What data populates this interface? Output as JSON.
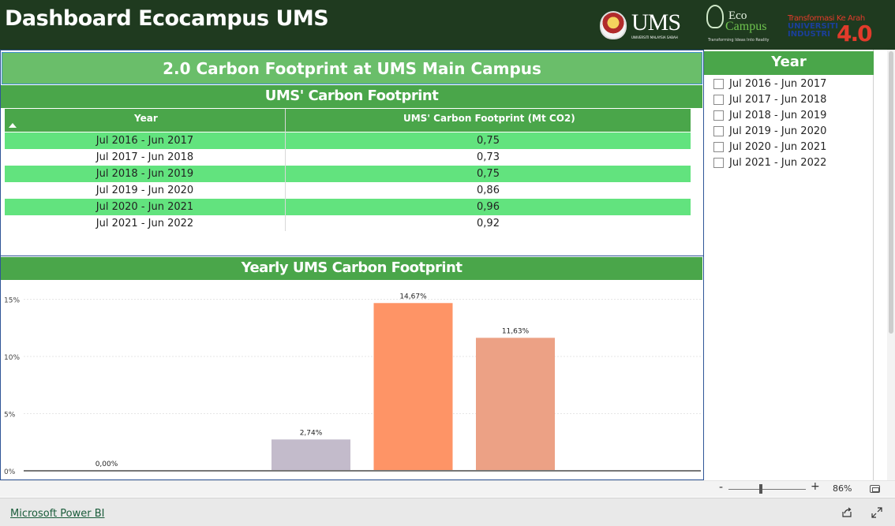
{
  "header": {
    "title": "Dashboard Ecocampus UMS",
    "logo_ums": {
      "text": "UMS",
      "subtitle": "UNIVERSITI MALAYSIA SABAH"
    },
    "logo_eco": {
      "line1": "Eco",
      "line2": "Campus",
      "tagline": "Transforming Ideas Into Reality"
    },
    "logo_ind": {
      "line1": "Transformasi Ke Arah",
      "line2": "UNIVERSITI",
      "line3": "INDUSTRI",
      "big": "4.0"
    }
  },
  "banner": {
    "title": "2.0 Carbon Footprint at UMS Main Campus"
  },
  "table_panel": {
    "title": "UMS' Carbon Footprint",
    "columns": [
      "Year",
      "UMS' Carbon Footprint (Mt CO2)"
    ],
    "rows": [
      [
        "Jul 2016 - Jun 2017",
        "0,75"
      ],
      [
        "Jul 2017 - Jun 2018",
        "0,73"
      ],
      [
        "Jul 2018 - Jun 2019",
        "0,75"
      ],
      [
        "Jul 2019 - Jun 2020",
        "0,86"
      ],
      [
        "Jul 2020 - Jun 2021",
        "0,96"
      ],
      [
        "Jul 2021 - Jun 2022",
        "0,92"
      ]
    ]
  },
  "chart_panel": {
    "title": "Yearly UMS Carbon Footprint"
  },
  "chart_data": {
    "type": "bar",
    "title": "Yearly UMS Carbon Footprint",
    "xlabel": "",
    "ylabel": "",
    "ylim": [
      0,
      16
    ],
    "yticks": [
      "0%",
      "5%",
      "10%",
      "15%"
    ],
    "ytick_values": [
      0,
      5,
      10,
      15
    ],
    "grid": true,
    "values": [
      0.0,
      -0.7,
      2.74,
      14.67,
      11.63,
      -0.7
    ],
    "labels": [
      "0,00%",
      "",
      "2,74%",
      "14,67%",
      "11,63%",
      ""
    ],
    "colors": [
      "#ffffff",
      "#a9c7ee",
      "#c3bbcb",
      "#fe9466",
      "#eca185",
      "#a9c7ee"
    ]
  },
  "slicer": {
    "title": "Year",
    "items": [
      "Jul 2016 - Jun 2017",
      "Jul 2017 - Jun 2018",
      "Jul 2018 - Jun 2019",
      "Jul 2019 - Jun 2020",
      "Jul 2020 - Jun 2021",
      "Jul 2021 - Jun 2022"
    ]
  },
  "zoom": {
    "minus": "-",
    "plus": "+",
    "level": "86%"
  },
  "footer": {
    "brand": "Microsoft Power BI"
  }
}
